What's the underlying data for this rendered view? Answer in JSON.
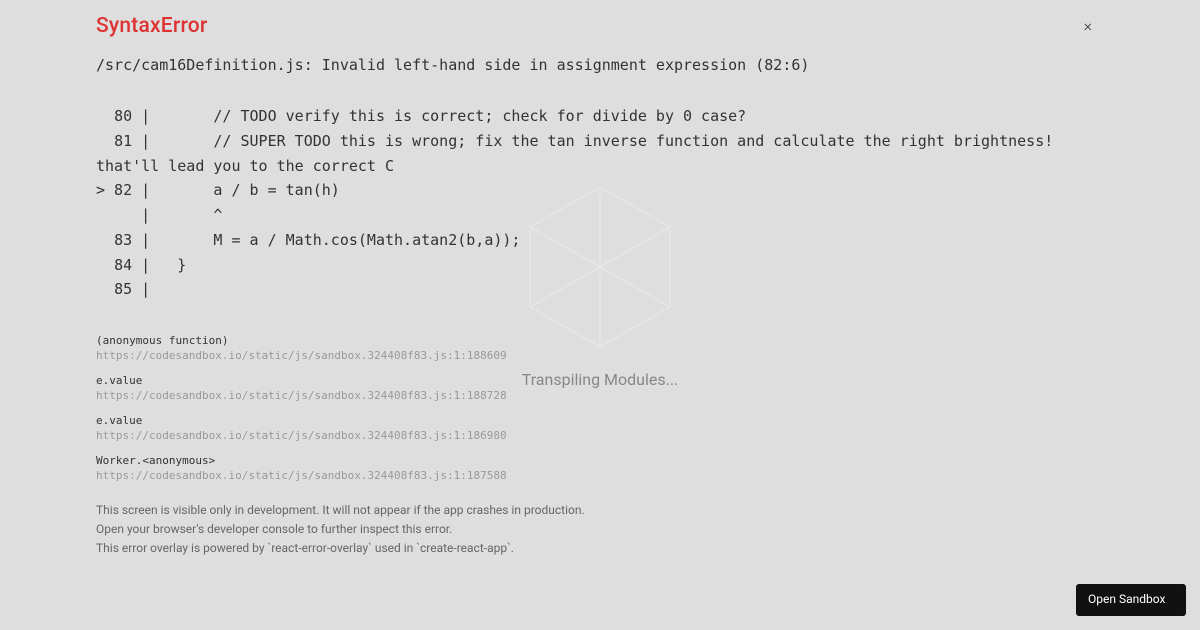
{
  "background": {
    "loading_text": "Transpiling Modules..."
  },
  "error": {
    "title": "SyntaxError",
    "location": "/src/cam16Definition.js: Invalid left-hand side in assignment expression (82:6)",
    "code": "  80 |       // TODO verify this is correct; check for divide by 0 case?\n  81 |       // SUPER TODO this is wrong; fix the tan inverse function and calculate the right brightness! that'll lead you to the correct C\n> 82 |       a / b = tan(h)\n     |       ^\n  83 |       M = a / Math.cos(Math.atan2(b,a));\n  84 |   }\n  85 |"
  },
  "stack": [
    {
      "func": "(anonymous function)",
      "url": "https://codesandbox.io/static/js/sandbox.324408f83.js:1:188609"
    },
    {
      "func": "e.value",
      "url": "https://codesandbox.io/static/js/sandbox.324408f83.js:1:188728"
    },
    {
      "func": "e.value",
      "url": "https://codesandbox.io/static/js/sandbox.324408f83.js:1:186980"
    },
    {
      "func": "Worker.<anonymous>",
      "url": "https://codesandbox.io/static/js/sandbox.324408f83.js:1:187588"
    }
  ],
  "footer": {
    "line1": "This screen is visible only in development. It will not appear if the app crashes in production.",
    "line2": "Open your browser's developer console to further inspect this error.",
    "line3": "This error overlay is powered by `react-error-overlay` used in `create-react-app`."
  },
  "buttons": {
    "open_sandbox": "Open Sandbox",
    "close": "×"
  }
}
